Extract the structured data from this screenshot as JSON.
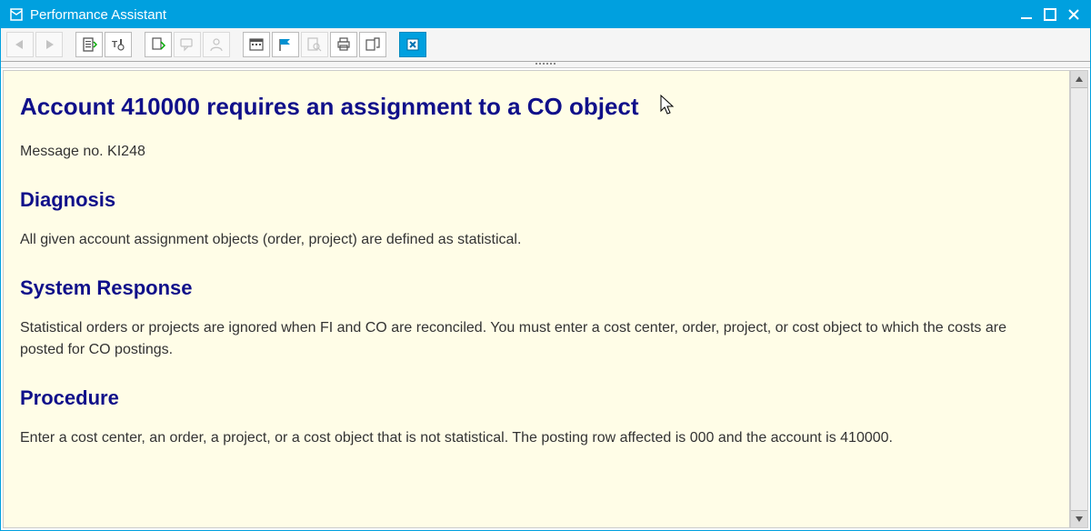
{
  "window": {
    "title": "Performance Assistant"
  },
  "toolbar": {
    "back": "Back",
    "forward": "Forward",
    "book": "Document",
    "tech": "Technical Info",
    "export": "Export",
    "chat": "Chat",
    "user": "User",
    "date": "Date",
    "flag": "Flag",
    "search_doc": "Search Doc",
    "print": "Print",
    "link": "Link",
    "close": "Close"
  },
  "message": {
    "title": "Account 410000 requires an assignment to a CO object",
    "msgno_label": "Message no. KI248",
    "diagnosis_heading": "Diagnosis",
    "diagnosis_text": "All given account assignment objects (order, project) are defined as statistical.",
    "system_response_heading": "System Response",
    "system_response_text": "Statistical orders or projects are ignored when FI and CO are reconciled. You must enter a cost center, order, project, or cost object to which the costs are posted for CO postings.",
    "procedure_heading": "Procedure",
    "procedure_text": "Enter a cost center, an order, a project, or a cost object that is not statistical. The posting row affected is 000 and the account is 410000."
  }
}
